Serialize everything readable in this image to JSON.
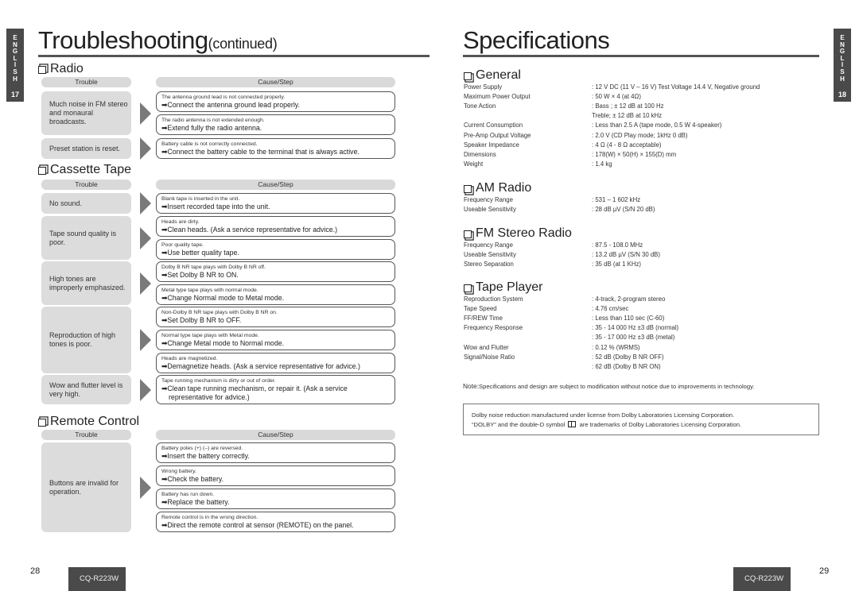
{
  "language_tab": {
    "letters": [
      "E",
      "N",
      "G",
      "L",
      "I",
      "S",
      "H"
    ],
    "left_page": "17",
    "right_page": "18"
  },
  "left": {
    "title": "Troubleshooting",
    "title_suffix": "(continued)",
    "column_headers": {
      "trouble": "Trouble",
      "cause": "Cause/Step"
    },
    "sections": [
      {
        "title": "Radio",
        "rows": [
          {
            "trouble": "Much noise in FM stereo and monaural broadcasts.",
            "causes": [
              {
                "cause": "The antenna ground lead is not connected properly.",
                "step": "➡Connect the antenna ground lead properly."
              },
              {
                "cause": "The radio antenna is not extended enough.",
                "step": "➡Extend fully the radio antenna."
              }
            ]
          },
          {
            "trouble": "Preset station is reset.",
            "causes": [
              {
                "cause": "Battery cable is not correctly connected.",
                "step": "➡Connect the battery cable to the terminal that is always active."
              }
            ]
          }
        ]
      },
      {
        "title": "Cassette Tape",
        "rows": [
          {
            "trouble": "No sound.",
            "causes": [
              {
                "cause": "Blank tape is inserted in the unit.",
                "step": "➡Insert recorded tape into the unit."
              }
            ]
          },
          {
            "trouble": "Tape sound quality is poor.",
            "causes": [
              {
                "cause": "Heads are dirty.",
                "step": "➡Clean heads. (Ask a service representative for advice.)"
              },
              {
                "cause": "Poor quality tape.",
                "step": "➡Use better quality tape."
              }
            ]
          },
          {
            "trouble": "High tones are improperly emphasized.",
            "causes": [
              {
                "cause": "Dolby B NR tape plays with Dolby B NR off.",
                "step": "➡Set Dolby B NR to ON."
              },
              {
                "cause": "Metal type tape plays with normal mode.",
                "step": "➡Change Normal mode to Metal mode."
              }
            ]
          },
          {
            "trouble": "Reproduction of high tones is poor.",
            "causes": [
              {
                "cause": "Non-Dolby B NR tape plays with Dolby B NR on.",
                "step": "➡Set Dolby B NR to OFF."
              },
              {
                "cause": "Normal type tape plays with Metal mode.",
                "step": "➡Change Metal mode to Normal mode."
              },
              {
                "cause": "Heads are magnetized.",
                "step": "➡Demagnetize heads. (Ask a service representative for advice.)"
              }
            ]
          },
          {
            "trouble": "Wow and flutter level is very high.",
            "causes": [
              {
                "cause": "Tape running mechanism is dirty or out of order.",
                "step": "➡Clean tape running mechanism, or repair it. (Ask a service",
                "step2": "representative for advice.)"
              }
            ]
          }
        ]
      },
      {
        "title": "Remote Control",
        "rows": [
          {
            "trouble": "Buttons are invalid for operation.",
            "causes": [
              {
                "cause": "Battery poles (+) (–) are reversed.",
                "step": "➡Insert the battery correctly."
              },
              {
                "cause": "Wrong battery.",
                "step": "➡Check the battery."
              },
              {
                "cause": "Battery has run down.",
                "step": "➡Replace the battery."
              },
              {
                "cause": "Remote control is in the wrong direction.",
                "step": "➡Direct the remote control at sensor (REMOTE) on the panel."
              }
            ]
          }
        ]
      }
    ],
    "page_number": "28",
    "model": "CQ-R223W"
  },
  "right": {
    "title": "Specifications",
    "groups": [
      {
        "title": "General",
        "rows": [
          {
            "label": "Power Supply",
            "value": ": 12 V DC (11 V – 16 V) Test Voltage 14.4 V, Negative ground"
          },
          {
            "label": "Maximum Power Output",
            "value": ": 50 W × 4 (at 4Ω)"
          },
          {
            "label": "Tone Action",
            "value": ": Bass  ; ± 12 dB at 100 Hz"
          },
          {
            "label": "",
            "value": "  Treble; ± 12 dB at 10 kHz"
          },
          {
            "label": "Current Consumption",
            "value": ": Less than 2.5 A (tape mode, 0.5 W  4-speaker)"
          },
          {
            "label": "Pre-Amp Output Voltage",
            "value": ": 2.0 V (CD Play mode; 1kHz  0 dB)"
          },
          {
            "label": "Speaker Impedance",
            "value": ": 4 Ω (4 - 8 Ω acceptable)"
          },
          {
            "label": "Dimensions",
            "value": ": 178(W) × 50(H) × 155(D) mm"
          },
          {
            "label": "Weight",
            "value": ": 1.4 kg"
          }
        ]
      },
      {
        "title": "AM Radio",
        "rows": [
          {
            "label": "Frequency Range",
            "value": ": 531 – 1 602 kHz"
          },
          {
            "label": "Useable Sensitivity",
            "value": ": 28 dB µV (S/N 20 dB)"
          }
        ]
      },
      {
        "title": "FM Stereo Radio",
        "rows": [
          {
            "label": "Frequency Range",
            "value": ": 87.5 - 108.0 MHz"
          },
          {
            "label": "Useable Sensitivity",
            "value": ": 13.2 dB µV (S/N 30 dB)"
          },
          {
            "label": "Stereo Separation",
            "value": ": 35 dB (at 1 KHz)"
          }
        ]
      },
      {
        "title": "Tape Player",
        "rows": [
          {
            "label": "Reproduction System",
            "value": ": 4-track, 2-program stereo"
          },
          {
            "label": "Tape Speed",
            "value": ": 4.76 cm/sec"
          },
          {
            "label": "FF/REW Time",
            "value": ": Less than 110 sec (C-60)"
          },
          {
            "label": "Frequency Response",
            "value": ": 35 - 14 000 Hz ±3 dB (normal)"
          },
          {
            "label": "",
            "value": ": 35 - 17 000 Hz ±3 dB (metal)"
          },
          {
            "label": "Wow and Flutter",
            "value": ": 0.12 % (WRMS)"
          },
          {
            "label": "Signal/Noise Ratio",
            "value": ": 52 dB (Dolby B NR OFF)"
          },
          {
            "label": "",
            "value": ": 62 dB (Dolby B NR ON)"
          }
        ]
      }
    ],
    "note_prefix": "Note:",
    "note": "Specifications and design are subject to modification without notice due to improvements in technology.",
    "dolby_line1": "Dolby noise reduction manufactured under license from Dolby Laboratories Licensing Corporation.",
    "dolby_line2a": "“DOLBY” and the double-D symbol",
    "dolby_line2b": "are trademarks of Dolby Laboratories Licensing Corporation.",
    "page_number": "29",
    "model": "CQ-R223W"
  }
}
